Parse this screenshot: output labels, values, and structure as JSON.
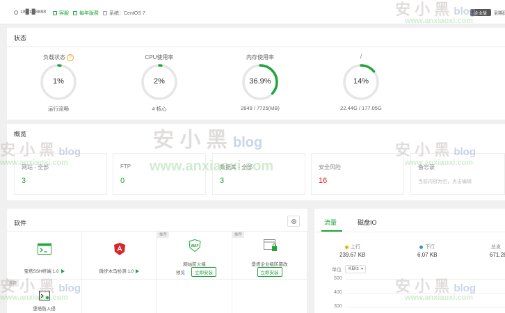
{
  "topbar": {
    "user": "18█1█8888",
    "link1": "客服",
    "link2": "每年版费",
    "system": "系统：CentOS 7",
    "badge": "企业版",
    "expire": "到期时"
  },
  "status": {
    "title": "状态",
    "gauges": [
      {
        "label": "负载状态",
        "value": "1%",
        "percent": 1,
        "sub": "运行流畅",
        "color": "#20a53a"
      },
      {
        "label": "CPU使用率",
        "value": "2%",
        "percent": 2,
        "sub": "4 核心",
        "color": "#20a53a"
      },
      {
        "label": "内存使用率",
        "value": "36.9%",
        "percent": 36.9,
        "sub": "2849 / 7725(MB)",
        "color": "#20a53a"
      },
      {
        "label": "/",
        "value": "14%",
        "percent": 14,
        "sub": "22.44G / 177.05G",
        "color": "#20a53a"
      }
    ]
  },
  "overview": {
    "title": "概览",
    "cards": [
      {
        "label": "网站 - 全部",
        "value": "3"
      },
      {
        "label": "FTP",
        "value": "0"
      },
      {
        "label": "数据库 - 全部",
        "value": "3"
      },
      {
        "label": "安全风险",
        "value": "16"
      },
      {
        "label": "备忘录",
        "hint": "当前内容为空，点击编辑"
      }
    ]
  },
  "software": {
    "title": "软件",
    "recommend_tag": "推荐",
    "items": [
      {
        "name": "宝塔SSH终端 1.0"
      },
      {
        "name": "微步木马检测 1.0"
      },
      {
        "name": "网站防火墙",
        "btn_preview": "预览",
        "btn_install": "立即安装"
      },
      {
        "name": "堡塔企业级防篡改",
        "btn_install": "立即安装"
      },
      {
        "name": "堡塔防入侵"
      }
    ]
  },
  "traffic": {
    "tab_traffic": "流量",
    "tab_disk": "磁盘IO",
    "up_label": "上行",
    "up_value": "239.67 KB",
    "down_label": "下行",
    "down_value": "6.07 KB",
    "total_label": "总发",
    "total_value": "671.28",
    "unit_label": "单位",
    "unit_value": "KB/s",
    "y_ticks": [
      "500",
      "400",
      "300"
    ],
    "up_color": "#f0b400",
    "down_color": "#3a8ee6"
  }
}
